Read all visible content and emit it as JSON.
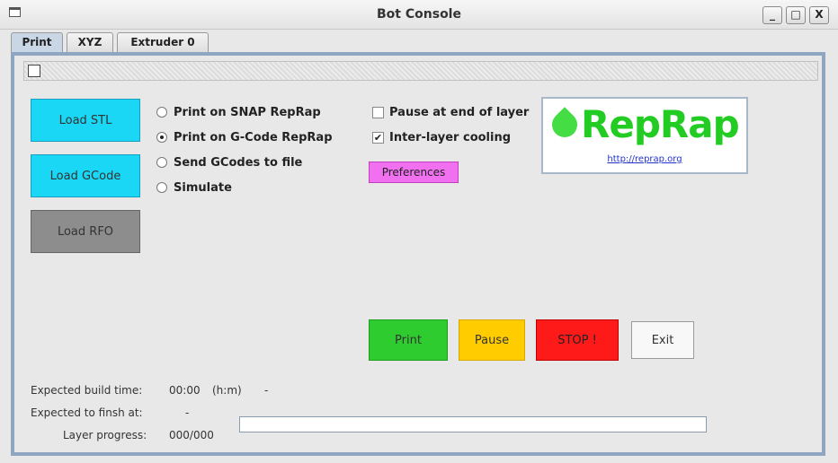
{
  "window": {
    "title": "Bot Console",
    "minimize_glyph": "_",
    "maximize_glyph": "□",
    "close_glyph": "X"
  },
  "tabs": [
    {
      "label": "Print",
      "active": true
    },
    {
      "label": "XYZ",
      "active": false
    },
    {
      "label": "Extruder 0",
      "active": false
    }
  ],
  "left_buttons": {
    "load_stl": "Load STL",
    "load_gcode": "Load GCode",
    "load_rfo": "Load RFO"
  },
  "print_mode": {
    "options": [
      {
        "label": "Print on SNAP RepRap",
        "selected": false
      },
      {
        "label": "Print on G-Code RepRap",
        "selected": true
      },
      {
        "label": "Send GCodes to file",
        "selected": false
      },
      {
        "label": "Simulate",
        "selected": false
      }
    ]
  },
  "options": {
    "pause_end_layer": {
      "label": "Pause at end of layer",
      "checked": false
    },
    "inter_layer_cooling": {
      "label": "Inter-layer cooling",
      "checked": true
    },
    "preferences_label": "Preferences"
  },
  "logo": {
    "text": "RepRap",
    "link": "http://reprap.org"
  },
  "actions": {
    "print": "Print",
    "pause": "Pause",
    "stop": "STOP !",
    "exit": "Exit"
  },
  "status": {
    "build_time_label": "Expected build time:",
    "build_time_value": "00:00",
    "build_time_unit": "(h:m)",
    "build_time_extra": "-",
    "finish_label": "Expected to finsh at:",
    "finish_value": "-",
    "layer_progress_label": "Layer progress:",
    "layer_progress_value": "000/000",
    "progress_fraction": 0
  },
  "colors": {
    "cyan_button": "#19d7f5",
    "grey_button": "#8d8d8d",
    "preferences": "#f070f0",
    "print": "#2ecc2e",
    "pause": "#ffcc00",
    "stop": "#ff1a1a",
    "logo_green": "#22cc22",
    "tab_border": "#8ea6c0"
  }
}
